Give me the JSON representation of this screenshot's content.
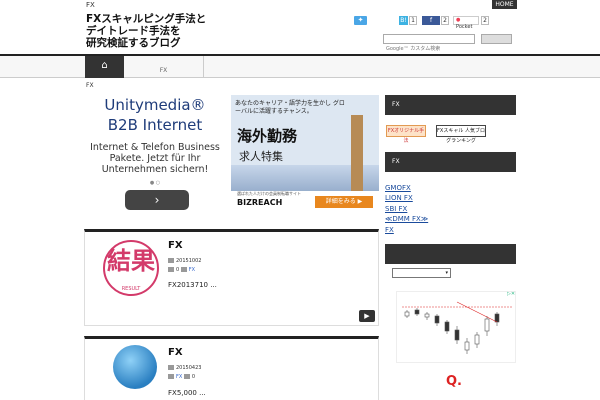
{
  "topbar": {
    "fx_label": "FX",
    "home_label": "HOME"
  },
  "site": {
    "title": "FXスキャルピング手法と\nデイトレード手法を\n研究検証するブログ"
  },
  "share": {
    "twitter_icon": "twitter-bird-icon",
    "hatena_glyph": "B!",
    "hatena_count": "1",
    "facebook_glyph": "f",
    "facebook_count": "2",
    "pocket_label": "Pocket",
    "pocket_count": "2"
  },
  "search": {
    "placeholder": "Google™ カスタム検索",
    "button_label": ""
  },
  "nav": {
    "home_icon": "home-icon",
    "items": [
      {
        "label": "FX"
      }
    ]
  },
  "breadcrumb": "FX",
  "ad_left": {
    "title_line1": "Unitymedia®",
    "title_line2": "B2B Internet",
    "text": "Internet & Telefon Business Pakete. Jetzt für Ihr Unternehmen sichern!",
    "dots": "● ○",
    "button_glyph": "›"
  },
  "ad_right": {
    "top_text": "あなたのキャリア・語学力を生かし グローバルに活躍するチャンス。",
    "big_text": "海外勤務",
    "sub_text": "求人特集",
    "micro_text": "選ばれた人だけの会員制転職サイト",
    "brand": "BIZREACH",
    "button_label": "詳細をみる ▶"
  },
  "posts": [
    {
      "title": "FX",
      "date": "20151002",
      "comments": "0",
      "category": "FX",
      "excerpt": "FX2013710 ...",
      "thumb_text": "結果",
      "thumb_sub": "RESULT"
    },
    {
      "title": "FX",
      "date": "20150423",
      "category": "FX",
      "comments": "0",
      "excerpt": "FX5,000 ..."
    }
  ],
  "sidebar": {
    "widget1_title": "FX",
    "banner1": "FXオリジナル手法",
    "banner2": "FXスキャル 人気ブログランキング",
    "widget2_title": "FX",
    "links": [
      "GMOFX",
      "LION FX",
      "SBI FX",
      "≪DMM FX≫",
      "FX"
    ],
    "widget3_title": "",
    "select_value": "▾",
    "chart_ad_close": "▷✕",
    "chart_ad_label": "Q."
  },
  "colors": {
    "accent_dark": "#333333",
    "link": "#1a4b9c",
    "stamp": "#d33a6a",
    "ad_orange": "#e8871e"
  }
}
